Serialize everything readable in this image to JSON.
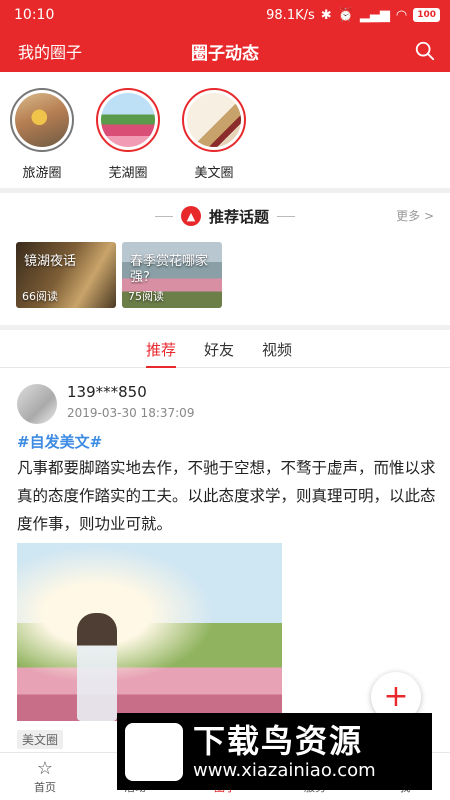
{
  "status": {
    "time": "10:10",
    "speed": "98.1K/s",
    "battery": "100"
  },
  "nav": {
    "left": "我的圈子",
    "title": "圈子动态"
  },
  "circles": [
    {
      "label": "旅游圈"
    },
    {
      "label": "芜湖圈"
    },
    {
      "label": "美文圈"
    }
  ],
  "topics": {
    "title": "推荐话题",
    "more": "更多 >",
    "cards": [
      {
        "name": "镜湖夜话",
        "reads": "66阅读"
      },
      {
        "name": "春季赏花哪家强?",
        "reads": "75阅读"
      }
    ]
  },
  "tabs": [
    "推荐",
    "好友",
    "视频"
  ],
  "post": {
    "user": "139***850",
    "time": "2019-03-30 18:37:09",
    "tag": "#自发美文#",
    "text": "凡事都要脚踏实地去作，不驰于空想，不骛于虚声，而惟以求真的态度作踏实的工夫。以此态度求学，则真理可明，以此态度作事，则功业可就。",
    "chip": "美文圈"
  },
  "fab": "+",
  "bottom_nav": [
    "首页",
    "活动",
    "圈子",
    "服务",
    "我"
  ],
  "watermark": {
    "big": "下载鸟资源",
    "url": "www.xiazainiao.com"
  },
  "colors": {
    "brand": "#e8292c",
    "link": "#3d8be3"
  }
}
